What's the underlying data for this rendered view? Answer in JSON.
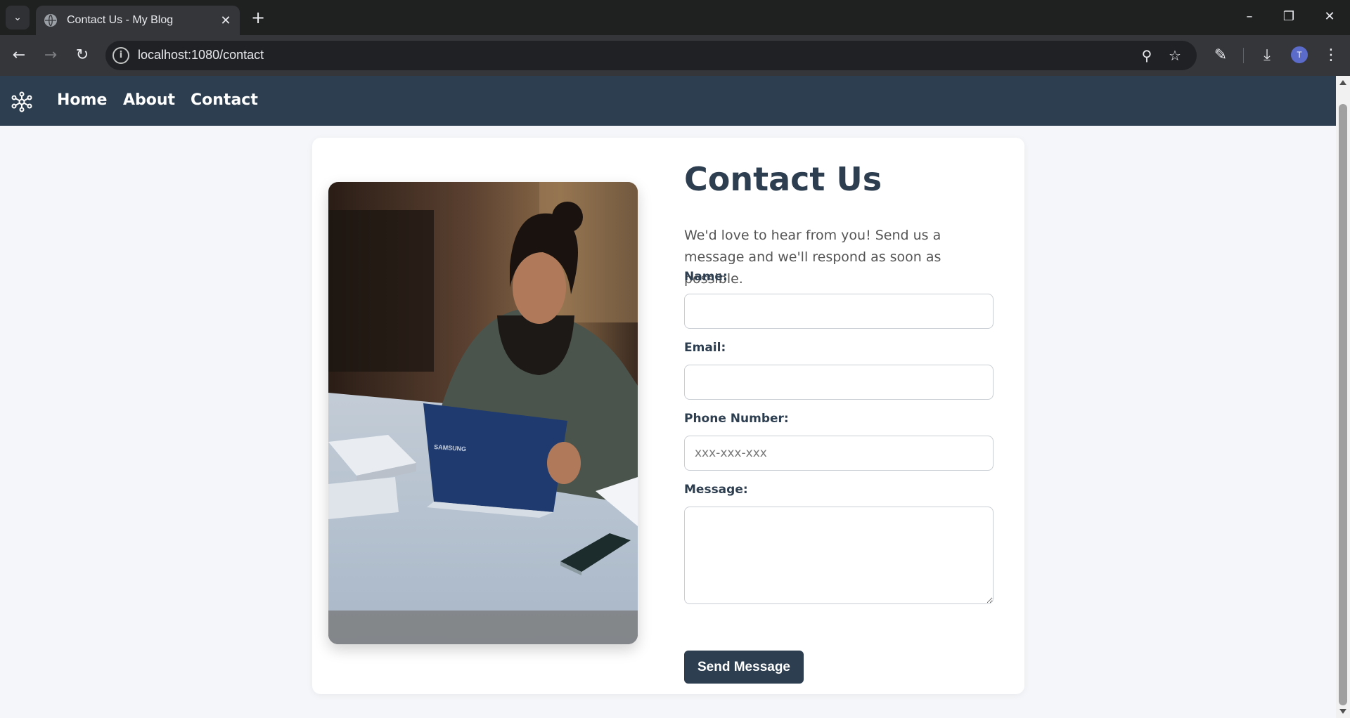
{
  "browser": {
    "tab_title": "Contact Us - My Blog",
    "url": "localhost:1080/contact",
    "profile_initial": "T",
    "icons": [
      "tab-search-icon",
      "globe-icon",
      "close-icon",
      "plus-icon",
      "minimize-icon",
      "restore-icon",
      "back-arrow-icon",
      "forward-arrow-icon",
      "reload-icon",
      "site-info-icon",
      "zoom-icon",
      "star-icon",
      "extensions-icon",
      "download-icon",
      "kebab-menu-icon"
    ]
  },
  "site_nav": {
    "links": [
      {
        "label": "Home"
      },
      {
        "label": "About"
      },
      {
        "label": "Contact"
      }
    ]
  },
  "contact": {
    "title": "Contact Us",
    "intro": "We'd love to hear from you! Send us a message and we'll respond as soon as possible.",
    "fields": {
      "name": {
        "label": "Name:",
        "value": ""
      },
      "email": {
        "label": "Email:",
        "value": ""
      },
      "phone": {
        "label": "Phone Number:",
        "placeholder": "xxx-xxx-xxx",
        "value": ""
      },
      "message": {
        "label": "Message:",
        "value": ""
      }
    },
    "submit_label": "Send Message",
    "photo_brand": "SAMSUNG"
  },
  "colors": {
    "nav_bg": "#2d3e50",
    "page_bg": "#f4f6f9",
    "heading": "#2d3e50",
    "button_bg": "#2d3e50"
  }
}
